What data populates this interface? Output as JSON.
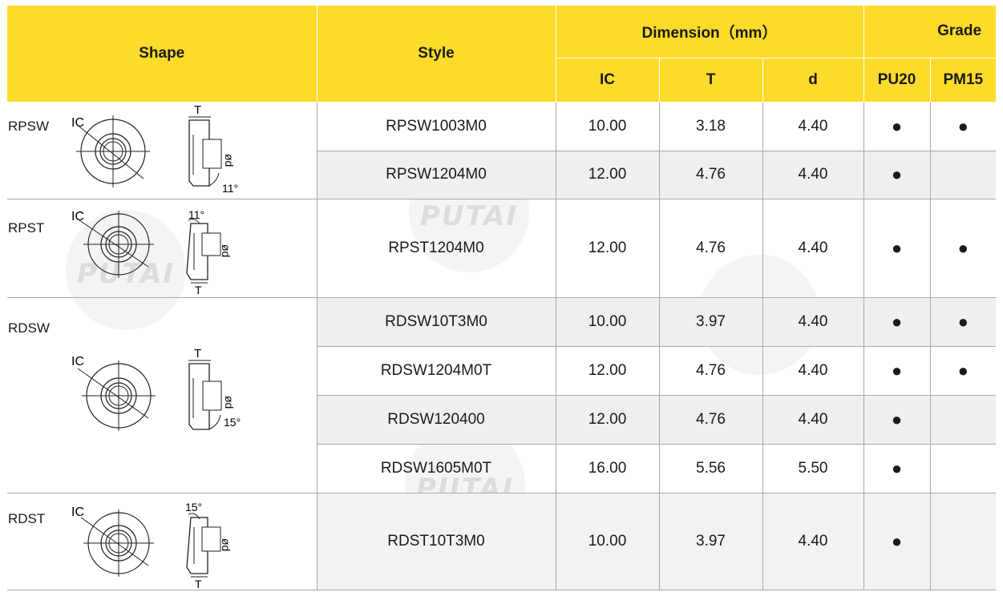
{
  "headers": {
    "shape": "Shape",
    "style": "Style",
    "dimension": "Dimension（mm）",
    "grade": "Grade",
    "ic": "IC",
    "t": "T",
    "d": "d",
    "pu20": "PU20",
    "pm15": "PM15"
  },
  "watermark": "PUTAI",
  "shapes": [
    {
      "name": "RPSW",
      "ic_label": "IC",
      "t_label": "T",
      "d_label": "ød",
      "angle": "11°"
    },
    {
      "name": "RPST",
      "ic_label": "IC",
      "t_label": "T",
      "d_label": "ød",
      "angle": "11°"
    },
    {
      "name": "RDSW",
      "ic_label": "IC",
      "t_label": "T",
      "d_label": "ød",
      "angle": "15°"
    },
    {
      "name": "RDST",
      "ic_label": "IC",
      "t_label": "T",
      "d_label": "ød",
      "angle": "15°"
    }
  ],
  "rows": [
    {
      "style": "RPSW1003M0",
      "ic": "10.00",
      "t": "3.18",
      "d": "4.40",
      "pu20": "●",
      "pm15": "●"
    },
    {
      "style": "RPSW1204M0",
      "ic": "12.00",
      "t": "4.76",
      "d": "4.40",
      "pu20": "●",
      "pm15": ""
    },
    {
      "style": "RPST1204M0",
      "ic": "12.00",
      "t": "4.76",
      "d": "4.40",
      "pu20": "●",
      "pm15": "●"
    },
    {
      "style": "RDSW10T3M0",
      "ic": "10.00",
      "t": "3.97",
      "d": "4.40",
      "pu20": "●",
      "pm15": "●"
    },
    {
      "style": "RDSW1204M0T",
      "ic": "12.00",
      "t": "4.76",
      "d": "4.40",
      "pu20": "●",
      "pm15": "●"
    },
    {
      "style": "RDSW120400",
      "ic": "12.00",
      "t": "4.76",
      "d": "4.40",
      "pu20": "●",
      "pm15": ""
    },
    {
      "style": "RDSW1605M0T",
      "ic": "16.00",
      "t": "5.56",
      "d": "5.50",
      "pu20": "●",
      "pm15": ""
    },
    {
      "style": "RDST10T3M0",
      "ic": "10.00",
      "t": "3.97",
      "d": "4.40",
      "pu20": "●",
      "pm15": ""
    }
  ]
}
